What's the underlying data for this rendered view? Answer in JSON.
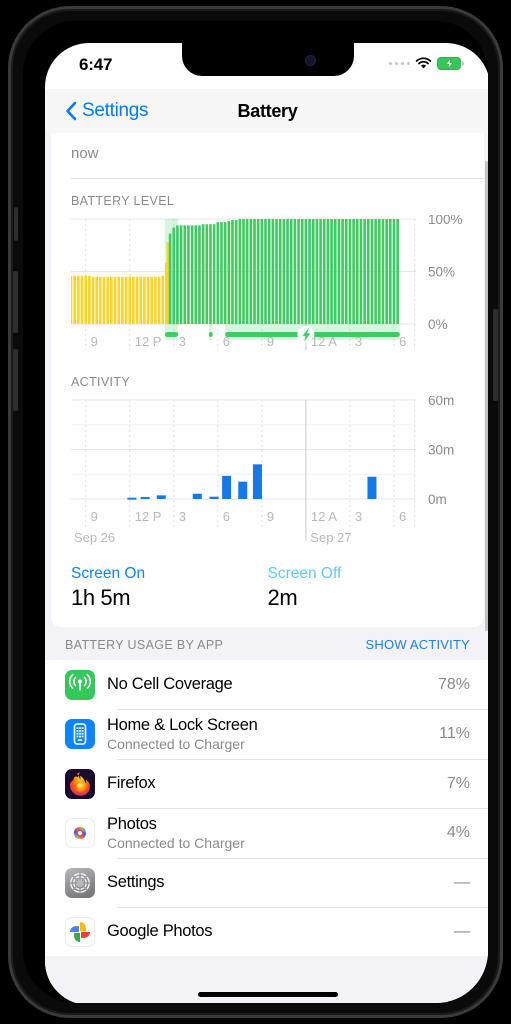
{
  "status_bar": {
    "time": "6:47",
    "signal_icon": "signal-dots-icon",
    "wifi_icon": "wifi-icon",
    "battery_icon": "battery-charging-icon"
  },
  "nav": {
    "back_label": "Settings",
    "back_icon": "chevron-left-icon",
    "title": "Battery"
  },
  "partial_row": {
    "subtitle": "now"
  },
  "battery_level_section": {
    "label": "BATTERY LEVEL"
  },
  "activity_section": {
    "label": "ACTIVITY"
  },
  "screen_stats": {
    "on_label": "Screen On",
    "on_value": "1h 5m",
    "off_label": "Screen Off",
    "off_value": "2m"
  },
  "usage_header": {
    "title": "BATTERY USAGE BY APP",
    "show_activity": "SHOW ACTIVITY"
  },
  "apps": [
    {
      "name": "No Cell Coverage",
      "sub": "",
      "pct": "78%",
      "icon": "cell-antenna-icon"
    },
    {
      "name": "Home & Lock Screen",
      "sub": "Connected to Charger",
      "pct": "11%",
      "icon": "home-screen-icon"
    },
    {
      "name": "Firefox",
      "sub": "",
      "pct": "7%",
      "icon": "firefox-icon"
    },
    {
      "name": "Photos",
      "sub": "Connected to Charger",
      "pct": "4%",
      "icon": "photos-icon"
    },
    {
      "name": "Settings",
      "sub": "",
      "pct": "—",
      "icon": "settings-gear-icon"
    },
    {
      "name": "Google Photos",
      "sub": "",
      "pct": "—",
      "icon": "google-photos-icon"
    }
  ],
  "colors": {
    "accent_blue": "#007aff",
    "link_blue": "#0a84ff",
    "screen_off_blue": "#64c8f5",
    "battery_green": "#3ecc60",
    "low_power_yellow": "#ffd426",
    "activity_blue": "#1479e8",
    "grid_gray": "#e6e6e8",
    "secondary_text": "#8a8a8e"
  },
  "chart_data": [
    {
      "type": "bar",
      "name": "battery-level-chart",
      "title": "BATTERY LEVEL",
      "xlabel": "",
      "ylabel": "",
      "ylim": [
        0,
        100
      ],
      "ytick_labels": [
        "100%",
        "50%",
        "0%"
      ],
      "ytick_values": [
        100,
        50,
        0
      ],
      "xtick_labels": [
        "9",
        "12 P",
        "3",
        "6",
        "9",
        "12 A",
        "3",
        "6"
      ],
      "xtick_hours": [
        9,
        12,
        15,
        18,
        21,
        24,
        27,
        30
      ],
      "x_start_hour": 8,
      "x_end_hour": 31.5,
      "grid": true,
      "unit": "percent",
      "series": [
        {
          "name": "Battery level",
          "color_low_power": "#ffd426",
          "color_normal": "#3ecc60",
          "values": [
            {
              "h": 8.0,
              "v": 46,
              "mode": "low_power"
            },
            {
              "h": 8.25,
              "v": 46,
              "mode": "low_power"
            },
            {
              "h": 8.5,
              "v": 46,
              "mode": "low_power"
            },
            {
              "h": 8.75,
              "v": 46,
              "mode": "low_power"
            },
            {
              "h": 9.0,
              "v": 46,
              "mode": "low_power"
            },
            {
              "h": 9.25,
              "v": 46,
              "mode": "low_power"
            },
            {
              "h": 9.5,
              "v": 45,
              "mode": "low_power"
            },
            {
              "h": 9.75,
              "v": 45,
              "mode": "low_power"
            },
            {
              "h": 10.0,
              "v": 45,
              "mode": "low_power"
            },
            {
              "h": 10.25,
              "v": 45,
              "mode": "low_power"
            },
            {
              "h": 10.5,
              "v": 45,
              "mode": "low_power"
            },
            {
              "h": 10.75,
              "v": 45,
              "mode": "low_power"
            },
            {
              "h": 11.0,
              "v": 45,
              "mode": "low_power"
            },
            {
              "h": 11.25,
              "v": 45,
              "mode": "low_power"
            },
            {
              "h": 11.5,
              "v": 45,
              "mode": "low_power"
            },
            {
              "h": 11.75,
              "v": 45,
              "mode": "low_power"
            },
            {
              "h": 12.0,
              "v": 45,
              "mode": "low_power"
            },
            {
              "h": 12.25,
              "v": 45,
              "mode": "low_power"
            },
            {
              "h": 12.5,
              "v": 45,
              "mode": "low_power"
            },
            {
              "h": 12.75,
              "v": 45,
              "mode": "low_power"
            },
            {
              "h": 13.0,
              "v": 45,
              "mode": "low_power"
            },
            {
              "h": 13.25,
              "v": 45,
              "mode": "low_power"
            },
            {
              "h": 13.5,
              "v": 45,
              "mode": "low_power"
            },
            {
              "h": 13.75,
              "v": 45,
              "mode": "low_power"
            },
            {
              "h": 14.0,
              "v": 45,
              "mode": "low_power"
            },
            {
              "h": 14.25,
              "v": 46,
              "mode": "low_power"
            },
            {
              "h": 14.5,
              "v": 58,
              "mode": "low_power"
            },
            {
              "h": 14.6,
              "v": 78,
              "mode": "low_power"
            },
            {
              "h": 14.75,
              "v": 86,
              "mode": "normal"
            },
            {
              "h": 15.0,
              "v": 92,
              "mode": "normal"
            },
            {
              "h": 15.25,
              "v": 94,
              "mode": "normal"
            },
            {
              "h": 15.5,
              "v": 94,
              "mode": "normal"
            },
            {
              "h": 15.75,
              "v": 94,
              "mode": "normal"
            },
            {
              "h": 16.0,
              "v": 94,
              "mode": "normal"
            },
            {
              "h": 16.25,
              "v": 94,
              "mode": "normal"
            },
            {
              "h": 16.5,
              "v": 94,
              "mode": "normal"
            },
            {
              "h": 16.75,
              "v": 94,
              "mode": "normal"
            },
            {
              "h": 17.0,
              "v": 95,
              "mode": "normal"
            },
            {
              "h": 17.25,
              "v": 95,
              "mode": "normal"
            },
            {
              "h": 17.5,
              "v": 95,
              "mode": "normal"
            },
            {
              "h": 17.75,
              "v": 95,
              "mode": "normal"
            },
            {
              "h": 18.0,
              "v": 97,
              "mode": "normal"
            },
            {
              "h": 18.25,
              "v": 97,
              "mode": "normal"
            },
            {
              "h": 18.5,
              "v": 97,
              "mode": "normal"
            },
            {
              "h": 18.75,
              "v": 98,
              "mode": "normal"
            },
            {
              "h": 19.0,
              "v": 99,
              "mode": "normal"
            },
            {
              "h": 19.25,
              "v": 99,
              "mode": "normal"
            },
            {
              "h": 19.5,
              "v": 100,
              "mode": "normal"
            },
            {
              "h": 19.75,
              "v": 100,
              "mode": "normal"
            },
            {
              "h": 20.0,
              "v": 100,
              "mode": "normal"
            },
            {
              "h": 20.25,
              "v": 100,
              "mode": "normal"
            },
            {
              "h": 20.5,
              "v": 100,
              "mode": "normal"
            },
            {
              "h": 20.75,
              "v": 100,
              "mode": "normal"
            },
            {
              "h": 21.0,
              "v": 100,
              "mode": "normal"
            },
            {
              "h": 21.25,
              "v": 100,
              "mode": "normal"
            },
            {
              "h": 21.5,
              "v": 100,
              "mode": "normal"
            },
            {
              "h": 21.75,
              "v": 100,
              "mode": "normal"
            },
            {
              "h": 22.0,
              "v": 100,
              "mode": "normal"
            },
            {
              "h": 22.25,
              "v": 100,
              "mode": "normal"
            },
            {
              "h": 22.5,
              "v": 100,
              "mode": "normal"
            },
            {
              "h": 22.75,
              "v": 100,
              "mode": "normal"
            },
            {
              "h": 23.0,
              "v": 100,
              "mode": "normal"
            },
            {
              "h": 23.25,
              "v": 100,
              "mode": "normal"
            },
            {
              "h": 23.5,
              "v": 100,
              "mode": "normal"
            },
            {
              "h": 23.75,
              "v": 100,
              "mode": "normal"
            },
            {
              "h": 24.0,
              "v": 100,
              "mode": "normal"
            },
            {
              "h": 24.25,
              "v": 100,
              "mode": "normal"
            },
            {
              "h": 24.5,
              "v": 100,
              "mode": "normal"
            },
            {
              "h": 24.75,
              "v": 100,
              "mode": "normal"
            },
            {
              "h": 25.0,
              "v": 100,
              "mode": "normal"
            },
            {
              "h": 25.25,
              "v": 100,
              "mode": "normal"
            },
            {
              "h": 25.5,
              "v": 100,
              "mode": "normal"
            },
            {
              "h": 25.75,
              "v": 100,
              "mode": "normal"
            },
            {
              "h": 26.0,
              "v": 100,
              "mode": "normal"
            },
            {
              "h": 26.25,
              "v": 100,
              "mode": "normal"
            },
            {
              "h": 26.5,
              "v": 100,
              "mode": "normal"
            },
            {
              "h": 26.75,
              "v": 100,
              "mode": "normal"
            },
            {
              "h": 27.0,
              "v": 100,
              "mode": "normal"
            },
            {
              "h": 27.25,
              "v": 100,
              "mode": "normal"
            },
            {
              "h": 27.5,
              "v": 100,
              "mode": "normal"
            },
            {
              "h": 27.75,
              "v": 100,
              "mode": "normal"
            },
            {
              "h": 28.0,
              "v": 100,
              "mode": "normal"
            },
            {
              "h": 28.25,
              "v": 100,
              "mode": "normal"
            },
            {
              "h": 28.5,
              "v": 100,
              "mode": "normal"
            },
            {
              "h": 28.75,
              "v": 100,
              "mode": "normal"
            },
            {
              "h": 29.0,
              "v": 100,
              "mode": "normal"
            },
            {
              "h": 29.25,
              "v": 100,
              "mode": "normal"
            },
            {
              "h": 29.5,
              "v": 100,
              "mode": "normal"
            },
            {
              "h": 29.75,
              "v": 100,
              "mode": "normal"
            },
            {
              "h": 30.0,
              "v": 100,
              "mode": "normal"
            },
            {
              "h": 30.25,
              "v": 100,
              "mode": "normal"
            }
          ]
        }
      ],
      "low_power_bands": [
        {
          "start": 14.4,
          "end": 15.3
        }
      ],
      "charging_bands": [
        {
          "start": 14.4,
          "end": 15.3
        },
        {
          "start": 17.4,
          "end": 17.65
        },
        {
          "start": 18.5,
          "end": 30.4
        }
      ],
      "charging_icon": "lightning-bolt-icon"
    },
    {
      "type": "bar",
      "name": "activity-chart",
      "title": "ACTIVITY",
      "xlabel": "",
      "ylabel": "",
      "ylim": [
        0,
        60
      ],
      "unit": "minutes",
      "ytick_labels": [
        "60m",
        "30m",
        "0m"
      ],
      "ytick_values": [
        60,
        30,
        0
      ],
      "xtick_labels": [
        "9",
        "12 P",
        "3",
        "6",
        "9",
        "12 A",
        "3",
        "6"
      ],
      "xtick_hours": [
        9,
        12,
        15,
        18,
        21,
        24,
        27,
        30
      ],
      "day_labels": [
        {
          "label": "Sep 26",
          "hour": 8.2
        },
        {
          "label": "Sep 27",
          "hour": 24.3
        }
      ],
      "x_start_hour": 8,
      "x_end_hour": 31.5,
      "grid": true,
      "bar_color": "#1479e8",
      "categories": [
        "12 PM",
        "1 PM",
        "2 PM",
        "4 PM",
        "6 PM",
        "6:30 PM",
        "7:30 PM",
        "8:30 PM",
        "5 AM"
      ],
      "values": [
        0.8,
        1.2,
        2.2,
        3.2,
        1.4,
        14.0,
        10.5,
        21.0,
        13.5
      ],
      "bars": [
        {
          "h": 12.15,
          "v": 0.8
        },
        {
          "h": 13.05,
          "v": 1.2
        },
        {
          "h": 14.15,
          "v": 2.2
        },
        {
          "h": 16.6,
          "v": 3.2
        },
        {
          "h": 17.75,
          "v": 1.4
        },
        {
          "h": 18.6,
          "v": 14.0
        },
        {
          "h": 19.7,
          "v": 10.5
        },
        {
          "h": 20.7,
          "v": 21.0
        },
        {
          "h": 28.5,
          "v": 13.5
        }
      ]
    }
  ]
}
